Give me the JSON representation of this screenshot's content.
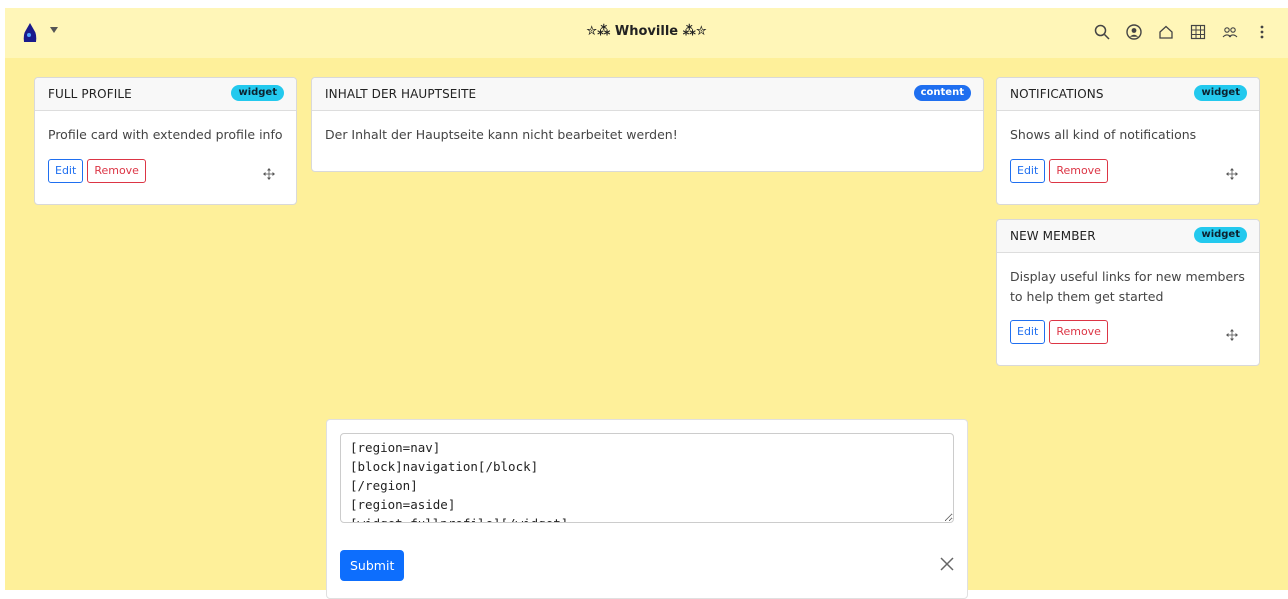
{
  "header": {
    "site_title": "✮⁂ Whoville ⁂✮",
    "icons": [
      "search-icon",
      "user-circle-icon",
      "home-icon",
      "grid-icon",
      "people-icon",
      "kebab-menu-icon"
    ]
  },
  "cards": {
    "full_profile": {
      "title": "FULL PROFILE",
      "badge": "widget",
      "description": "Profile card with extended profile info",
      "edit": "Edit",
      "remove": "Remove"
    },
    "main_content": {
      "title": "INHALT DER HAUPTSEITE",
      "badge": "content",
      "description": "Der Inhalt der Hauptseite kann nicht bearbeitet werden!"
    },
    "notifications": {
      "title": "NOTIFICATIONS",
      "badge": "widget",
      "description": "Shows all kind of notifications",
      "edit": "Edit",
      "remove": "Remove"
    },
    "new_member": {
      "title": "NEW MEMBER",
      "badge": "widget",
      "description": "Display useful links for new members to help them get started",
      "edit": "Edit",
      "remove": "Remove"
    }
  },
  "form": {
    "editor_lines": [
      "[region=nav]",
      "[block]navigation[/block]",
      "[/region]",
      "[region=aside]",
      "[widget=fullprofile][/widget]"
    ],
    "submit": "Submit"
  },
  "colors": {
    "page_bg": "#fef09a",
    "topbar_bg": "#fff6b8",
    "widget_badge": "#23c9ee",
    "content_badge": "#1f6ff0",
    "primary": "#0d6efd",
    "danger": "#dc3545"
  }
}
